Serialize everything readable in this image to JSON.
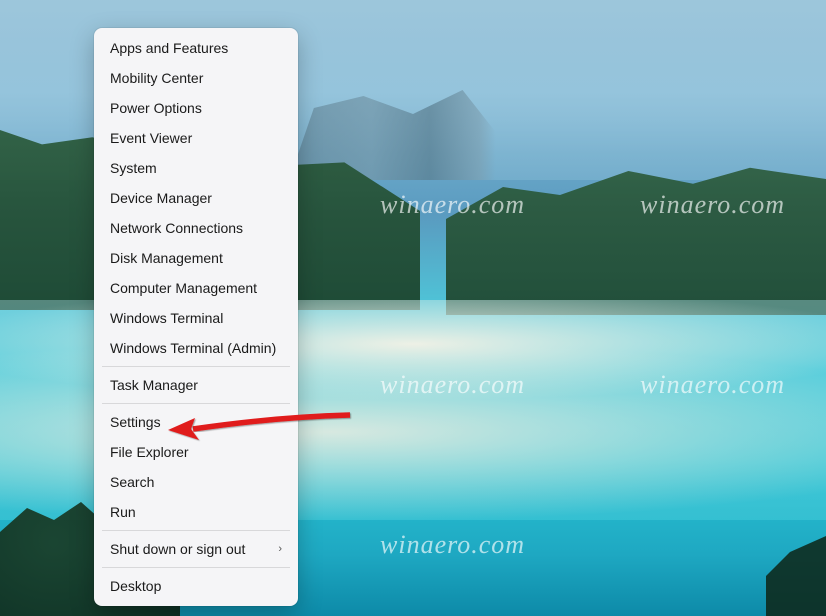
{
  "watermark_text": "winaero.com",
  "menu": {
    "items": [
      {
        "label": "Apps and Features",
        "has_submenu": false
      },
      {
        "label": "Mobility Center",
        "has_submenu": false
      },
      {
        "label": "Power Options",
        "has_submenu": false
      },
      {
        "label": "Event Viewer",
        "has_submenu": false
      },
      {
        "label": "System",
        "has_submenu": false
      },
      {
        "label": "Device Manager",
        "has_submenu": false
      },
      {
        "label": "Network Connections",
        "has_submenu": false
      },
      {
        "label": "Disk Management",
        "has_submenu": false
      },
      {
        "label": "Computer Management",
        "has_submenu": false
      },
      {
        "label": "Windows Terminal",
        "has_submenu": false
      },
      {
        "label": "Windows Terminal (Admin)",
        "has_submenu": false
      },
      {
        "label": "Task Manager",
        "has_submenu": false
      },
      {
        "label": "Settings",
        "has_submenu": false
      },
      {
        "label": "File Explorer",
        "has_submenu": false
      },
      {
        "label": "Search",
        "has_submenu": false
      },
      {
        "label": "Run",
        "has_submenu": false
      },
      {
        "label": "Shut down or sign out",
        "has_submenu": true
      },
      {
        "label": "Desktop",
        "has_submenu": false
      }
    ],
    "separators_after_index": [
      10,
      11,
      15,
      16
    ],
    "highlighted_index": 12
  },
  "annotation": {
    "type": "arrow",
    "color": "#e01b1b",
    "target_item": "Settings"
  }
}
